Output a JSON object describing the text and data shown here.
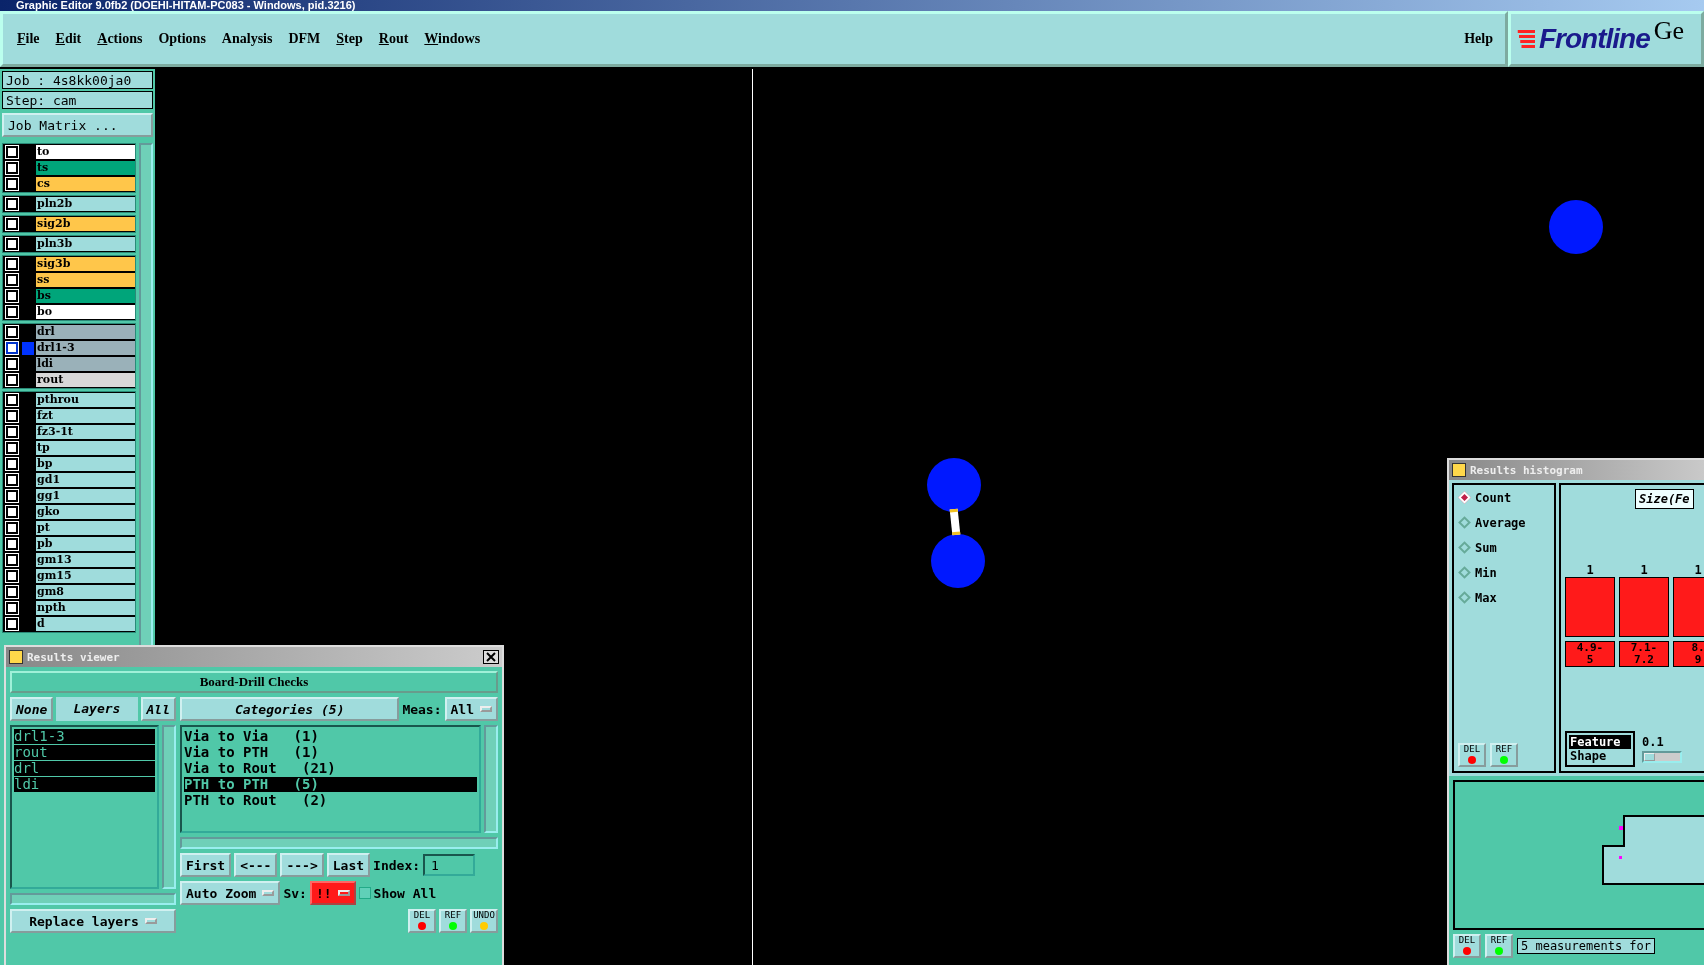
{
  "window": {
    "title": "Graphic Editor 9.0fb2 (DOEHI-HITAM-PC083 - Windows, pid.3216)"
  },
  "menu": [
    {
      "label": "File",
      "mnemonic": true
    },
    {
      "label": "Edit",
      "mnemonic": true
    },
    {
      "label": "Actions",
      "mnemonic": true
    },
    {
      "label": "Options",
      "mnemonic": false
    },
    {
      "label": "Analysis",
      "mnemonic": false
    },
    {
      "label": "DFM",
      "mnemonic": false
    },
    {
      "label": "Step",
      "mnemonic": true
    },
    {
      "label": "Rout",
      "mnemonic": true
    },
    {
      "label": "Windows",
      "mnemonic": true
    }
  ],
  "help": "Help",
  "logo": {
    "text": "Frontline",
    "side_text": "Ge"
  },
  "job": {
    "job_label": "Job : 4s8kk00ja0",
    "step_label": "Step: cam",
    "matrix_button": "Job Matrix ..."
  },
  "layer_groups": [
    [
      {
        "name": "to",
        "color": "#ffffff",
        "selected": false,
        "checked": false
      },
      {
        "name": "ts",
        "color": "#00a57a",
        "selected": false,
        "checked": false
      },
      {
        "name": "cs",
        "color": "#ffc64a",
        "selected": false,
        "checked": false
      }
    ],
    [
      {
        "name": "pln2b",
        "color": "#9fdcdc",
        "selected": false,
        "checked": false
      }
    ],
    [
      {
        "name": "sig2b",
        "color": "#ffc64a",
        "selected": false,
        "checked": false
      }
    ],
    [
      {
        "name": "pln3b",
        "color": "#9fdcdc",
        "selected": false,
        "checked": false
      }
    ],
    [
      {
        "name": "sig3b",
        "color": "#ffc64a",
        "selected": false,
        "checked": false
      },
      {
        "name": "ss",
        "color": "#ffc64a",
        "selected": false,
        "checked": false
      },
      {
        "name": "bs",
        "color": "#00a57a",
        "selected": false,
        "checked": false
      },
      {
        "name": "bo",
        "color": "#ffffff",
        "selected": false,
        "checked": false
      }
    ],
    [
      {
        "name": "drl",
        "color": "#9ab1b9",
        "selected": false,
        "checked": false
      },
      {
        "name": "drl1-3",
        "color": "#9ab1b9",
        "selected": true,
        "checked": false
      },
      {
        "name": "ldi",
        "color": "#9ab1b9",
        "selected": false,
        "checked": false
      },
      {
        "name": "rout",
        "color": "#d8d8d8",
        "selected": false,
        "checked": false
      }
    ],
    [
      {
        "name": "pthrou",
        "color": "#9fdcdc",
        "selected": false,
        "checked": false
      },
      {
        "name": "fzt",
        "color": "#9fdcdc",
        "selected": false,
        "checked": false
      },
      {
        "name": "fz3-1t",
        "color": "#9fdcdc",
        "selected": false,
        "checked": false
      },
      {
        "name": "tp",
        "color": "#9fdcdc",
        "selected": false,
        "checked": false
      },
      {
        "name": "bp",
        "color": "#9fdcdc",
        "selected": false,
        "checked": false
      },
      {
        "name": "gd1",
        "color": "#9fdcdc",
        "selected": false,
        "checked": false
      },
      {
        "name": "gg1",
        "color": "#9fdcdc",
        "selected": false,
        "checked": false
      },
      {
        "name": "gko",
        "color": "#9fdcdc",
        "selected": false,
        "checked": false
      },
      {
        "name": "pt",
        "color": "#9fdcdc",
        "selected": false,
        "checked": false
      },
      {
        "name": "pb",
        "color": "#9fdcdc",
        "selected": false,
        "checked": false
      },
      {
        "name": "gm13",
        "color": "#9fdcdc",
        "selected": false,
        "checked": false
      },
      {
        "name": "gm15",
        "color": "#9fdcdc",
        "selected": false,
        "checked": false
      },
      {
        "name": "gm8",
        "color": "#9fdcdc",
        "selected": false,
        "checked": false
      },
      {
        "name": "npth",
        "color": "#9fdcdc",
        "selected": false,
        "checked": false
      },
      {
        "name": "d",
        "color": "#9fdcdc",
        "selected": false,
        "checked": false
      }
    ]
  ],
  "results_viewer": {
    "title": "Results viewer",
    "heading": "Board-Drill Checks",
    "layer_buttons": [
      {
        "label": "None",
        "kind": "button"
      },
      {
        "label": "Layers",
        "kind": "header"
      },
      {
        "label": "All",
        "kind": "button"
      }
    ],
    "layers": [
      {
        "name": "drl1-3",
        "selected": true
      },
      {
        "name": "rout",
        "selected": true
      },
      {
        "name": "drl",
        "selected": true
      },
      {
        "name": "ldi",
        "selected": true
      }
    ],
    "replace": "Replace layers",
    "categories_title": "Categories (5)",
    "meas_label": "Meas:",
    "meas_value": "All",
    "categories": [
      {
        "label": "Via to Via   (1)",
        "selected": false
      },
      {
        "label": "Via to PTH   (1)",
        "selected": false
      },
      {
        "label": "Via to Rout   (21)",
        "selected": false
      },
      {
        "label": "PTH to PTH   (5)",
        "selected": true
      },
      {
        "label": "PTH to Rout   (2)",
        "selected": false
      }
    ],
    "nav": [
      "First",
      "<---",
      "--->",
      "Last"
    ],
    "index_label": "Index:",
    "index_value": "1",
    "zoom": "Auto Zoom",
    "sv_label": "Sv:",
    "sv_value": "!!",
    "show_all": {
      "label": "Show All",
      "checked": false
    },
    "actions": [
      "DEL",
      "REF",
      "UNDO"
    ]
  },
  "histogram": {
    "title": "Results histogram",
    "modes": [
      {
        "label": "Count",
        "selected": true
      },
      {
        "label": "Average",
        "selected": false
      },
      {
        "label": "Sum",
        "selected": false
      },
      {
        "label": "Min",
        "selected": false
      },
      {
        "label": "Max",
        "selected": false
      }
    ],
    "axis_title": "Size(Fe",
    "bins": [
      {
        "count": "1",
        "range": [
          "4.9-",
          "5"
        ]
      },
      {
        "count": "1",
        "range": [
          "7.1-",
          "7.2"
        ]
      },
      {
        "count": "1",
        "range": [
          "8.",
          "9"
        ]
      }
    ],
    "attributes": [
      {
        "label": "Feature",
        "selected": true
      },
      {
        "label": "Shape",
        "selected": false
      }
    ],
    "step_value": "0.1",
    "step_slider": {
      "level": 0.3
    },
    "actions": [
      "DEL",
      "REF"
    ],
    "bottom_actions": [
      "DEL",
      "REF"
    ],
    "status": "5 measurements for"
  }
}
